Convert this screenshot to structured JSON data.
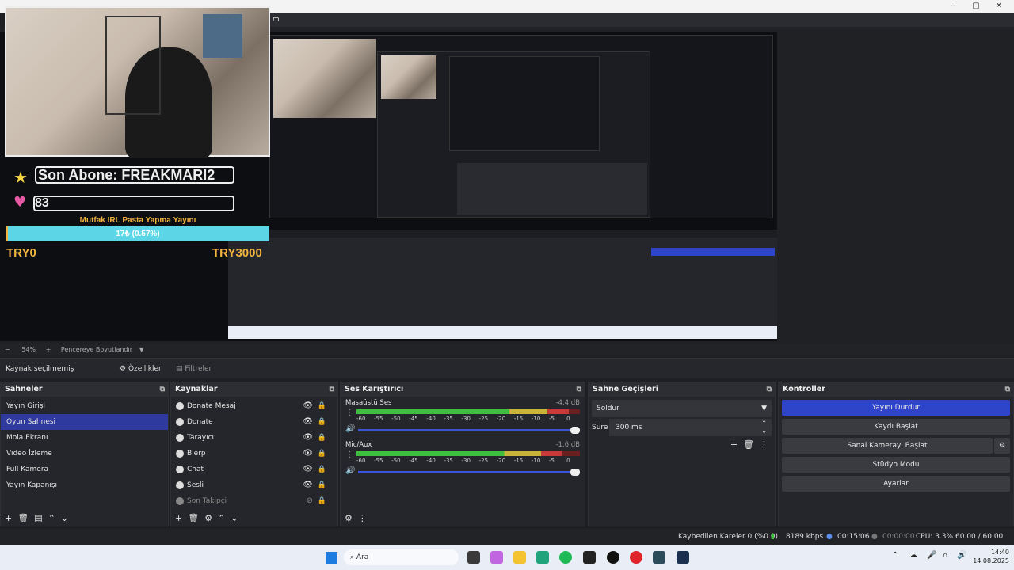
{
  "window": {
    "controls": [
      "–",
      "▢",
      "✕"
    ],
    "menu_fragment": "m"
  },
  "overlay": {
    "last_sub": "Son Abone: FREAKMARI2",
    "count": "83",
    "goal_title": "Mutfak IRL Pasta Yapma Yayını",
    "goal_progress_text": "17₺ (0.57%)",
    "goal_progress": 0.0057,
    "goal_min": "TRY0",
    "goal_max": "TRY3000"
  },
  "zoom": {
    "value": "54%",
    "mode": "Pencereye Boyutlandır"
  },
  "props_bar": {
    "label": "Kaynak seçilmemiş",
    "properties": "Özellikler",
    "filters": "Filtreler"
  },
  "scenes": {
    "title": "Sahneler",
    "items": [
      "Yayın Girişi",
      "Oyun Sahnesi",
      "Mola Ekranı",
      "Video İzleme",
      "Full Kamera",
      "Yayın Kapanışı"
    ],
    "selected": 1
  },
  "sources": {
    "title": "Kaynaklar",
    "items": [
      "Donate Mesaj",
      "Donate",
      "Tarayıcı",
      "Blerp",
      "Chat",
      "Sesli",
      "Son Takipçi"
    ]
  },
  "mixer": {
    "title": "Ses Karıştırıcı",
    "channels": [
      {
        "name": "Masaüstü Ses",
        "db": "-4.4 dB",
        "level": 0.95
      },
      {
        "name": "Mic/Aux",
        "db": "-1.6 dB",
        "level": 0.92
      }
    ],
    "scale": [
      "-60",
      "-55",
      "-50",
      "-45",
      "-40",
      "-35",
      "-30",
      "-25",
      "-20",
      "-15",
      "-10",
      "-5",
      "0"
    ]
  },
  "transitions": {
    "title": "Sahne Geçişleri",
    "selected": "Soldur",
    "duration_label": "Süre",
    "duration": "300 ms"
  },
  "controls": {
    "title": "Kontroller",
    "buttons": [
      "Yayını Durdur",
      "Kaydı Başlat",
      "Sanal Kamerayı Başlat",
      "Stüdyo Modu",
      "Ayarlar"
    ]
  },
  "status": {
    "dropped": "Kaybedilen Kareler 0 (%0.0)",
    "kbps": "8189 kbps",
    "stream_time": "00:15:06",
    "rec_time": "00:00:00",
    "cpu": "CPU: 3.3%",
    "fps": "60.00 / 60.00 FPS"
  },
  "taskbar": {
    "search": "Ara",
    "time": "14:40",
    "date": "14.08.2025"
  },
  "colors": {
    "accent": "#2f45c9",
    "meter_green": "#3fbf3f",
    "meter_yellow": "#c8b43a",
    "meter_red": "#c83a3a"
  }
}
